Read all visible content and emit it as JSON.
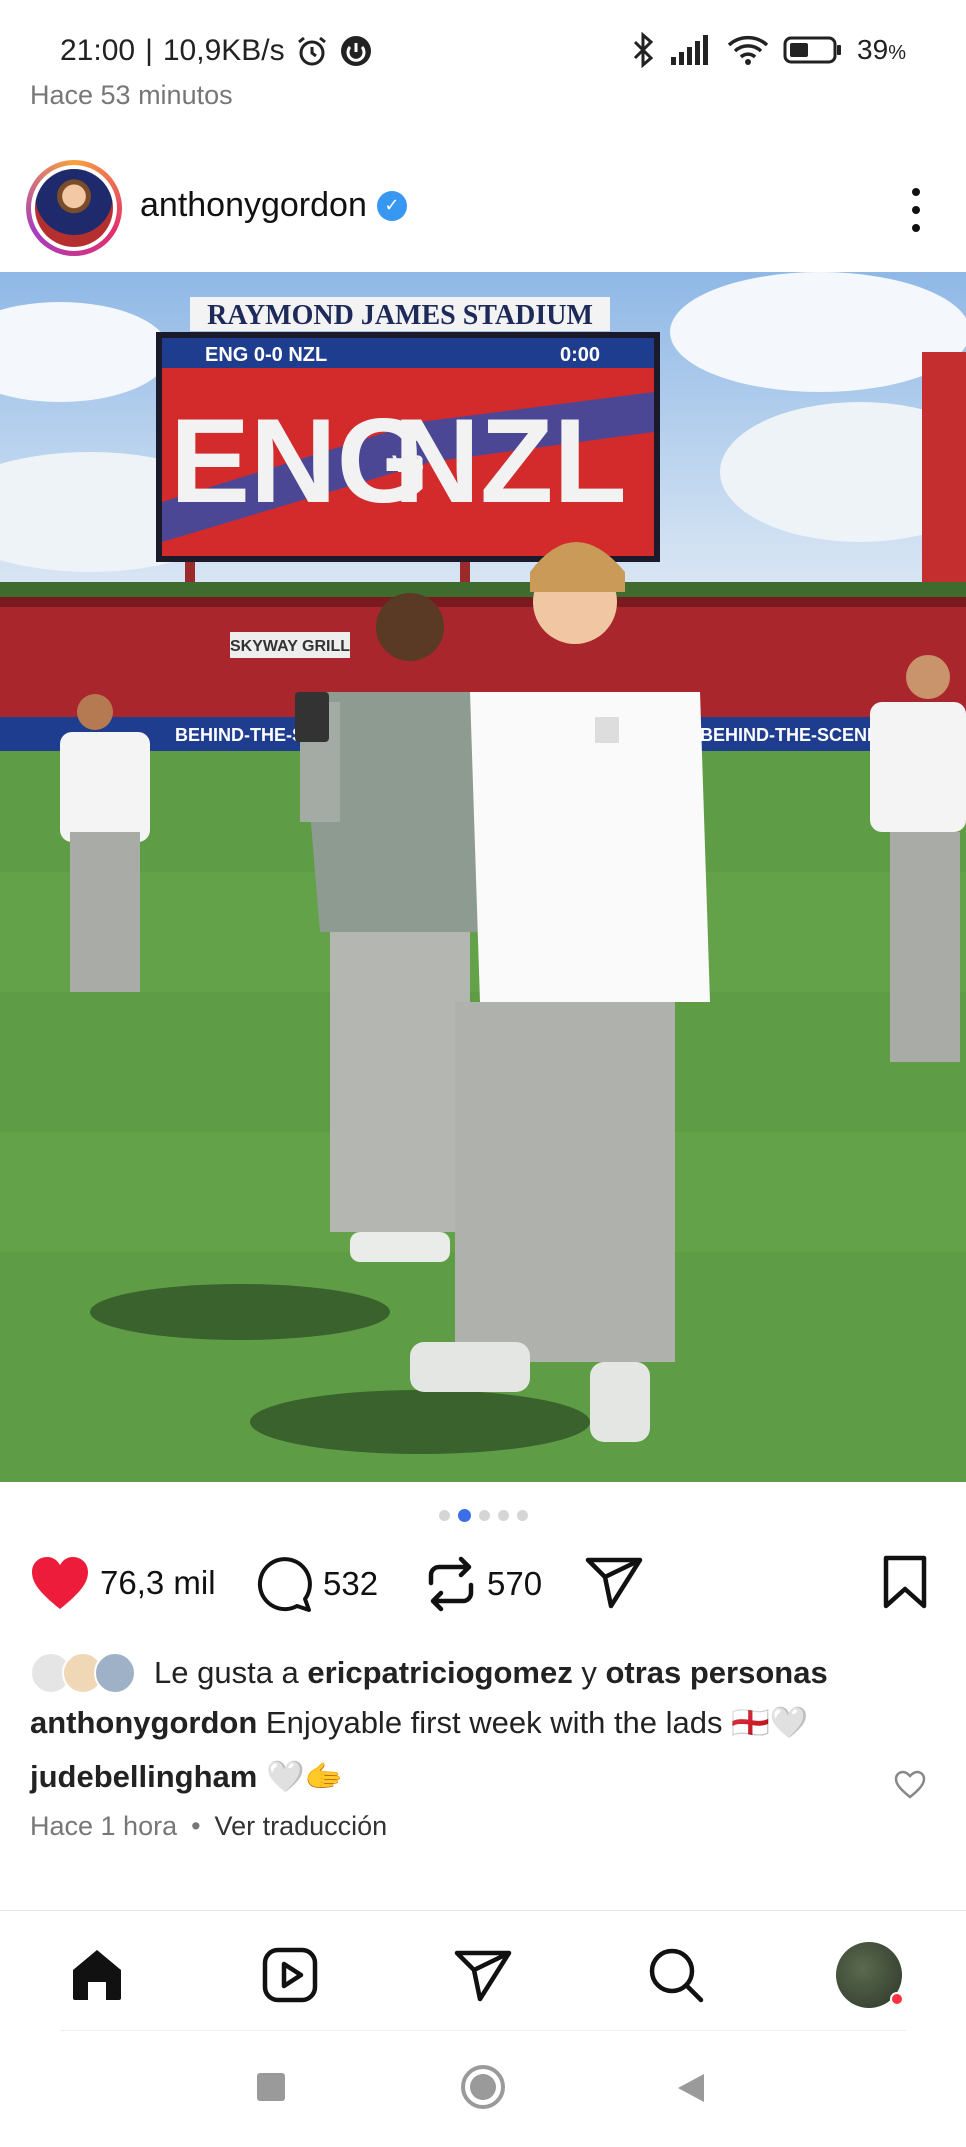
{
  "status_bar": {
    "time": "21:00",
    "separator": "|",
    "network_speed": "10,9KB/s",
    "battery": "39",
    "battery_unit": "%"
  },
  "feed": {
    "previous_post_time": "Hace 53 minutos"
  },
  "post": {
    "username": "anthonygordon",
    "verified": true,
    "image_pages": 5,
    "active_page": 2,
    "likes": "76,3 mil",
    "comments": "532",
    "reposts": "570",
    "liked_by_prefix": "Le gusta a ",
    "liked_by_user": "ericpatriciogomez",
    "liked_by_conj": " y ",
    "liked_by_others": "otras personas",
    "caption_user": "anthonygordon",
    "caption_text": " Enjoyable first week with the lads 🏴󠁧󠁢󠁥󠁮󠁧󠁿🤍",
    "comment_user": "judebellingham",
    "comment_text": " 🤍🫱",
    "time_ago": "Hace 1 hora",
    "meta_separator": "•",
    "translate": "Ver traducción"
  },
  "photo": {
    "scoreboard_title": "RAYMOND JAMES STADIUM",
    "score_left": "ENG 0-0 NZL",
    "clock": "0:00",
    "home_team": "ENG",
    "versus": "VS",
    "away_team": "NZL",
    "sign_grill": "SKYWAY GRILL",
    "sign_banner": "BEHIND-THE-SCENE"
  },
  "colors": {
    "accent": "#3b6ee8",
    "like": "#ed1c3a",
    "verified": "#3897f0",
    "notification": "#ff3040"
  }
}
